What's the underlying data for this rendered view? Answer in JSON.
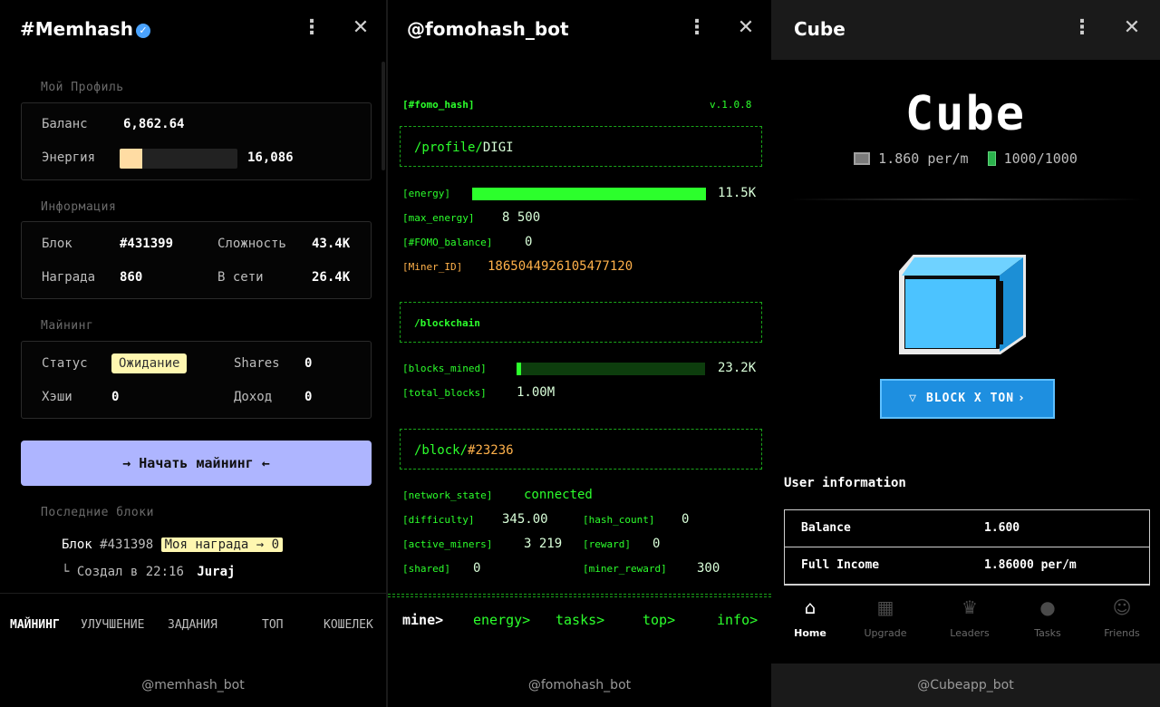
{
  "memhash": {
    "title": "#Memhash",
    "profile_label": "Мой Профиль",
    "balance_label": "Баланс",
    "balance_value": "6,862.64",
    "energy_label": "Энергия",
    "energy_value": "16,086",
    "energy_fill_fraction": 0.19,
    "info_label": "Информация",
    "block_label": "Блок",
    "block_value": "#431399",
    "difficulty_label": "Сложность",
    "difficulty_value": "43.4K",
    "reward_label": "Награда",
    "reward_value": "860",
    "online_label": "В сети",
    "online_value": "26.4K",
    "mining_label": "Майнинг",
    "status_label": "Статус",
    "status_value": "Ожидание",
    "shares_label": "Shares",
    "shares_value": "0",
    "hashes_label": "Хэши",
    "hashes_value": "0",
    "income_label": "Доход",
    "income_value": "0",
    "start_button": "→ Начать майнинг ←",
    "recent_label": "Последние блоки",
    "recent_block_prefix": "Блок",
    "recent_block_id": "#431398",
    "recent_reward_tag": "Моя награда → 0",
    "created_prefix": "└",
    "created_text": "Создал в 22:16",
    "created_by": "Juraj",
    "nav": [
      "МАЙНИНГ",
      "УЛУЧШЕНИЕ",
      "ЗАДАНИЯ",
      "ТОП",
      "КОШЕЛЕК"
    ],
    "footer": "@memhash_bot"
  },
  "fomo": {
    "title": "@fomohash_bot",
    "tag": "[#fomo_hash]",
    "version": "v.1.0.8",
    "profile_path": "/profile/",
    "profile_name": "DIGI",
    "energy_key": "[energy]",
    "energy_value": "11.5K",
    "energy_fill_fraction": 1.0,
    "max_energy_key": "[max_energy]",
    "max_energy_value": "8 500",
    "balance_key": "[#FOMO_balance]",
    "balance_value": "0",
    "miner_key": "[Miner_ID]",
    "miner_value": "1865044926105477120",
    "blockchain_path": "/blockchain",
    "blocks_mined_key": "[blocks_mined]",
    "blocks_mined_value": "23.2K",
    "blocks_mined_fill_fraction": 0.02,
    "total_blocks_key": "[total_blocks]",
    "total_blocks_value": "1.00M",
    "block_path": "/block/",
    "block_id": "#23236",
    "network_state_key": "[network_state]",
    "network_state_value": "connected",
    "difficulty_key": "[difficulty]",
    "difficulty_value": "345.00",
    "hash_count_key": "[hash_count]",
    "hash_count_value": "0",
    "active_miners_key": "[active_miners]",
    "active_miners_value": "3 219",
    "reward_key": "[reward]",
    "reward_value": "0",
    "shared_key": "[shared]",
    "shared_value": "0",
    "miner_reward_key": "[miner_reward]",
    "miner_reward_value": "300",
    "nav": [
      "mine>",
      "energy>",
      "tasks>",
      "top>",
      "info>"
    ],
    "footer": "@fomohash_bot"
  },
  "cube": {
    "title": "Cube",
    "logo": "Cube",
    "rate": "1.860 per/m",
    "energy": "1000/1000",
    "block_button": "BLOCK X TON",
    "user_info_title": "User information",
    "balance_label": "Balance",
    "balance_value": "1.600",
    "income_label": "Full Income",
    "income_value": "1.86000 per/m",
    "nav": [
      "Home",
      "Upgrade",
      "Leaders",
      "Tasks",
      "Friends"
    ],
    "footer": "@Cubeapp_bot"
  },
  "colors": {
    "memhash_button": "#aeb5ff",
    "memhash_pill": "#fff7b0",
    "terminal_green": "#2cff2c",
    "terminal_orange": "#ffb14a",
    "cube_button": "#1e8fe0",
    "cube_face": "#4cc3ff"
  },
  "icons": [
    "verified-icon",
    "more-icon",
    "close-icon",
    "arrow-icon",
    "cube-icon",
    "battery-icon",
    "ton-icon",
    "home-icon",
    "upgrade-icon",
    "trophy-icon",
    "tasks-icon",
    "friends-icon"
  ]
}
